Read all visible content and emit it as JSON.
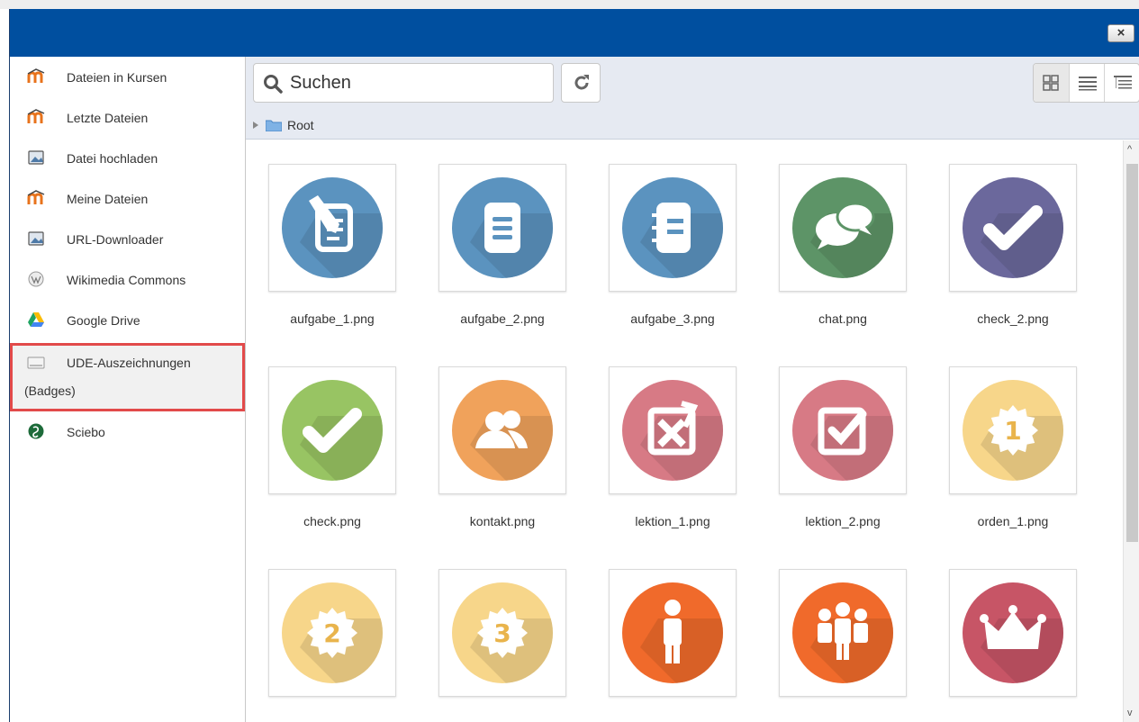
{
  "dialog": {
    "close_label": "×"
  },
  "sidebar": {
    "items": [
      {
        "label": "Dateien in Kursen",
        "icon": "moodle-icon"
      },
      {
        "label": "Letzte Dateien",
        "icon": "moodle-icon"
      },
      {
        "label": "Datei hochladen",
        "icon": "upload-icon"
      },
      {
        "label": "Meine Dateien",
        "icon": "moodle-icon"
      },
      {
        "label": "URL-Downloader",
        "icon": "url-downloader-icon"
      },
      {
        "label": "Wikimedia Commons",
        "icon": "wikimedia-icon"
      },
      {
        "label": "Google Drive",
        "icon": "google-drive-icon"
      },
      {
        "label": "UDE-Auszeichnungen",
        "label_line2": "(Badges)",
        "icon": "badges-icon",
        "active": true
      },
      {
        "label": "Sciebo",
        "icon": "sciebo-icon"
      }
    ]
  },
  "toolbar": {
    "search_placeholder": "Suchen",
    "breadcrumb_root": "Root"
  },
  "files": [
    {
      "name": "aufgabe_1.png",
      "color": "#5b93bf",
      "glyph": "edit"
    },
    {
      "name": "aufgabe_2.png",
      "color": "#5b93bf",
      "glyph": "doc"
    },
    {
      "name": "aufgabe_3.png",
      "color": "#5b93bf",
      "glyph": "notebook"
    },
    {
      "name": "chat.png",
      "color": "#5d9467",
      "glyph": "chat"
    },
    {
      "name": "check_2.png",
      "color": "#6b689c",
      "glyph": "check"
    },
    {
      "name": "check.png",
      "color": "#98c463",
      "glyph": "check"
    },
    {
      "name": "kontakt.png",
      "color": "#f0a25b",
      "glyph": "users"
    },
    {
      "name": "lektion_1.png",
      "color": "#d77a85",
      "glyph": "boxx"
    },
    {
      "name": "lektion_2.png",
      "color": "#d77a85",
      "glyph": "boxcheck"
    },
    {
      "name": "orden_1.png",
      "color": "#f7d68a",
      "glyph": "medal",
      "text": "1"
    },
    {
      "name": "",
      "color": "#f7d68a",
      "glyph": "medal",
      "text": "2"
    },
    {
      "name": "",
      "color": "#f7d68a",
      "glyph": "medal",
      "text": "3"
    },
    {
      "name": "",
      "color": "#f06a2b",
      "glyph": "person"
    },
    {
      "name": "",
      "color": "#f06a2b",
      "glyph": "group"
    },
    {
      "name": "",
      "color": "#c75566",
      "glyph": "crown"
    }
  ]
}
